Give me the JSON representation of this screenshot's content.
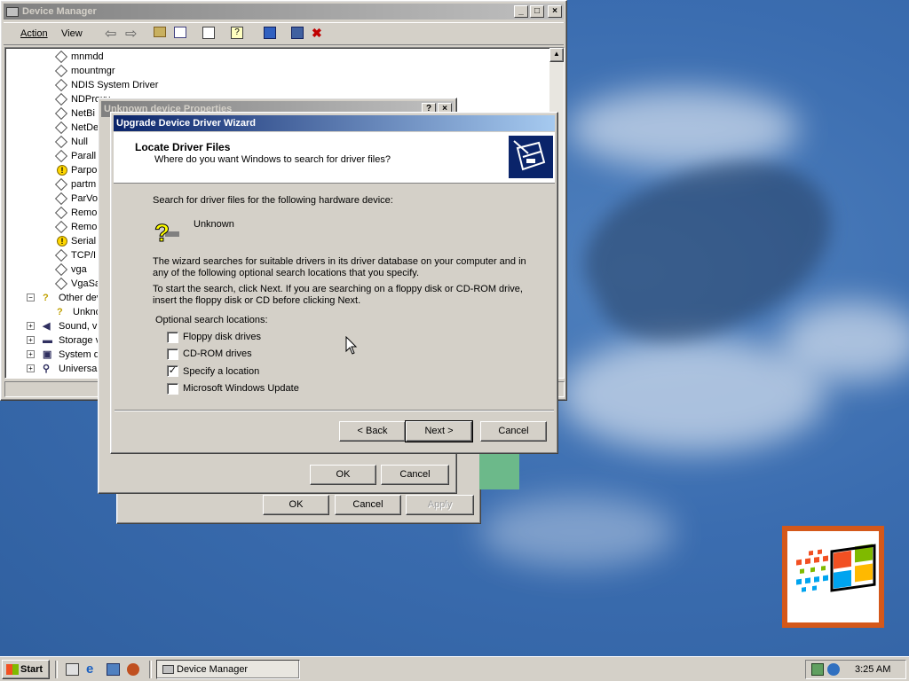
{
  "desktop": {
    "logo_colors": [
      "#f25022",
      "#7fba00",
      "#00a4ef",
      "#ffb900"
    ]
  },
  "device_manager": {
    "title": "Device Manager",
    "menu": {
      "action": "Action",
      "view": "View"
    },
    "tree": [
      {
        "label": "mnmdd",
        "icon": "diamond"
      },
      {
        "label": "mountmgr",
        "icon": "diamond"
      },
      {
        "label": "NDIS System Driver",
        "icon": "diamond"
      },
      {
        "label": "NDProxy",
        "icon": "diamond"
      },
      {
        "label": "NetBi",
        "icon": "diamond"
      },
      {
        "label": "NetDe",
        "icon": "diamond"
      },
      {
        "label": "Null",
        "icon": "diamond"
      },
      {
        "label": "Parall",
        "icon": "diamond"
      },
      {
        "label": "Parpo",
        "icon": "warning"
      },
      {
        "label": "partm",
        "icon": "diamond"
      },
      {
        "label": "ParVo",
        "icon": "diamond"
      },
      {
        "label": "Remo",
        "icon": "diamond"
      },
      {
        "label": "Remo",
        "icon": "diamond"
      },
      {
        "label": "Serial",
        "icon": "warning"
      },
      {
        "label": "TCP/I",
        "icon": "diamond"
      },
      {
        "label": "vga",
        "icon": "diamond"
      },
      {
        "label": "VgaSa",
        "icon": "diamond"
      }
    ],
    "categories": [
      {
        "label": "Other dev",
        "icon": "question"
      },
      {
        "label": "Unkno",
        "icon": "question"
      },
      {
        "label": "Sound, vi",
        "icon": "speaker"
      },
      {
        "label": "Storage v",
        "icon": "drive"
      },
      {
        "label": "System de",
        "icon": "computer"
      },
      {
        "label": "Universal",
        "icon": "usb"
      }
    ]
  },
  "properties_dialog": {
    "title": "Unknown device Properties",
    "ok_label": "OK",
    "cancel_label": "Cancel"
  },
  "back_dialog": {
    "ok_label": "OK",
    "cancel_label": "Cancel",
    "apply_label": "Apply"
  },
  "wizard": {
    "title": "Upgrade Device Driver Wizard",
    "header_title": "Locate Driver Files",
    "header_subtitle": "Where do you want Windows to search for driver files?",
    "intro": "Search for driver files for the following hardware device:",
    "device_name": "Unknown",
    "para1_line1": "The wizard searches for suitable drivers in its driver database on your computer and in",
    "para1_line2": "any of the following optional search locations that you specify.",
    "para2_line1": "To start the search, click Next. If you are searching on a floppy disk or CD-ROM drive,",
    "para2_line2": "insert the floppy disk or CD before clicking Next.",
    "options_label": "Optional search locations:",
    "options": [
      {
        "label": "Floppy disk drives",
        "checked": false
      },
      {
        "label": "CD-ROM drives",
        "checked": false
      },
      {
        "label": "Specify a location",
        "checked": true
      },
      {
        "label": "Microsoft Windows Update",
        "checked": false
      }
    ],
    "back_label": "< Back",
    "next_label": "Next >",
    "cancel_label": "Cancel"
  },
  "taskbar": {
    "start_label": "Start",
    "task_label": "Device Manager",
    "clock": "3:25 AM"
  }
}
